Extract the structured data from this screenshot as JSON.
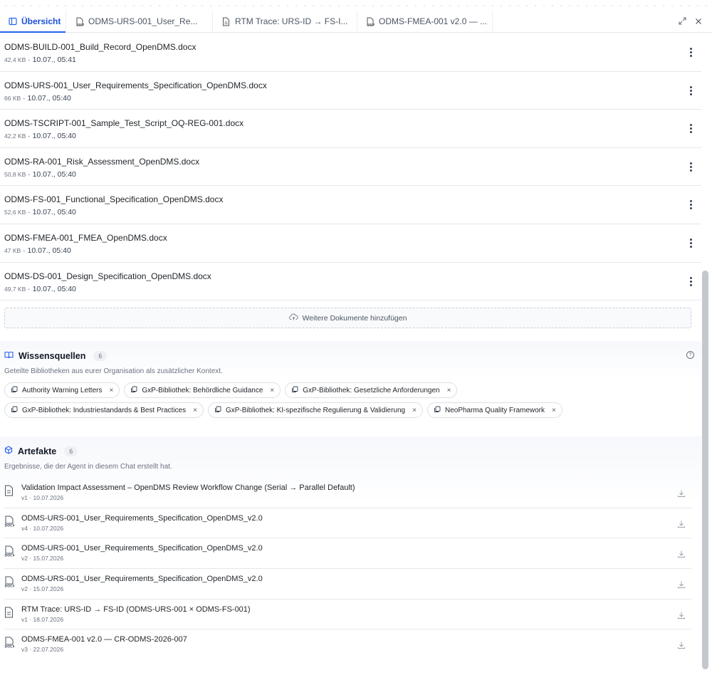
{
  "tabs": [
    {
      "label": "Übersicht",
      "icon": "panel-icon",
      "active": true
    },
    {
      "label": "ODMS-URS-001_User_Re...",
      "icon": "docx-icon",
      "active": false
    },
    {
      "label": "RTM Trace: URS-ID → FS-I...",
      "icon": "document-icon",
      "active": false
    },
    {
      "label": "ODMS-FMEA-001 v2.0 — ...",
      "icon": "docx-icon",
      "active": false
    }
  ],
  "files": [
    {
      "name": "ODMS-BUILD-001_Build_Record_OpenDMS.docx",
      "size": "42,4 KB",
      "date": "· 10.07., 05:41"
    },
    {
      "name": "ODMS-URS-001_User_Requirements_Specification_OpenDMS.docx",
      "size": "66 KB",
      "date": "· 10.07., 05:40"
    },
    {
      "name": "ODMS-TSCRIPT-001_Sample_Test_Script_OQ-REG-001.docx",
      "size": "42,2 KB",
      "date": "· 10.07., 05:40"
    },
    {
      "name": "ODMS-RA-001_Risk_Assessment_OpenDMS.docx",
      "size": "50,8 KB",
      "date": "· 10.07., 05:40"
    },
    {
      "name": "ODMS-FS-001_Functional_Specification_OpenDMS.docx",
      "size": "52,6 KB",
      "date": "· 10.07., 05:40"
    },
    {
      "name": "ODMS-FMEA-001_FMEA_OpenDMS.docx",
      "size": "47 KB",
      "date": "· 10.07., 05:40"
    },
    {
      "name": "ODMS-DS-001_Design_Specification_OpenDMS.docx",
      "size": "49,7 KB",
      "date": "· 10.07., 05:40"
    }
  ],
  "add_docs_label": "Weitere Dokumente hinzufügen",
  "wissensquellen": {
    "title": "Wissensquellen",
    "count": "6",
    "subtitle": "Geteilte Bibliotheken aus eurer Organisation als zusätzlicher Kontext.",
    "chips": [
      "Authority Warning Letters",
      "GxP-Bibliothek: Behördliche Guidance",
      "GxP-Bibliothek: Gesetzliche Anforderungen",
      "GxP-Bibliothek: Industriestandards & Best Practices",
      "GxP-Bibliothek: KI-spezifische Regulierung & Validierung",
      "NeoPharma Quality Framework"
    ]
  },
  "artefakte": {
    "title": "Artefakte",
    "count": "6",
    "subtitle": "Ergebnisse, die der Agent in diesem Chat erstellt hat.",
    "items": [
      {
        "name": "Validation Impact Assessment – OpenDMS Review Workflow Change (Serial → Parallel Default)",
        "meta": "v1 · 10.07.2026",
        "icon": "document-icon"
      },
      {
        "name": "ODMS-URS-001_User_Requirements_Specification_OpenDMS_v2.0",
        "meta": "v4 · 10.07.2026",
        "icon": "docx-icon"
      },
      {
        "name": "ODMS-URS-001_User_Requirements_Specification_OpenDMS_v2.0",
        "meta": "v2 · 15.07.2026",
        "icon": "docx-icon"
      },
      {
        "name": "ODMS-URS-001_User_Requirements_Specification_OpenDMS_v2.0",
        "meta": "v2 · 15.07.2026",
        "icon": "docx-icon"
      },
      {
        "name": "RTM Trace: URS-ID → FS-ID (ODMS-URS-001 × ODMS-FS-001)",
        "meta": "v1 · 18.07.2026",
        "icon": "document-icon"
      },
      {
        "name": "ODMS-FMEA-001 v2.0 — CR-ODMS-2026-007",
        "meta": "v3 · 22.07.2026",
        "icon": "docx-icon"
      }
    ]
  },
  "colors": {
    "accent": "#2563eb",
    "border": "#e5e7eb",
    "muted": "#6b7280"
  }
}
